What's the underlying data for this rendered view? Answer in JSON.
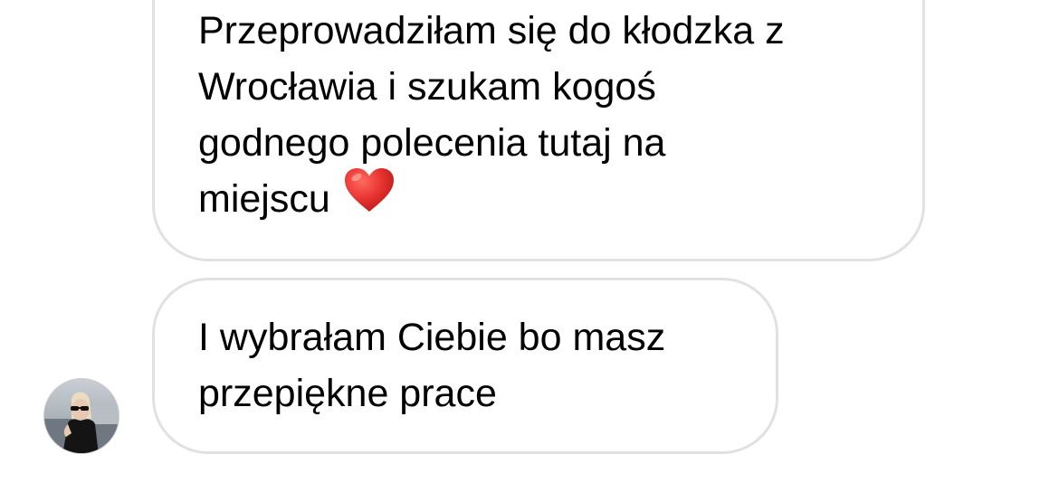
{
  "messages": [
    {
      "lines": [
        "Przeprowadziłam się do kłodzka z",
        "Wrocławia i szukam kogoś",
        "godnego polecenia tutaj na",
        "miejscu"
      ],
      "emoji": "red-heart"
    },
    {
      "lines": [
        "I wybrałam Ciebie bo masz",
        "przepiękne prace"
      ]
    }
  ],
  "colors": {
    "bubble_border": "#e1e1e1",
    "text": "#000000",
    "heart": "#e8332f",
    "background": "#ffffff"
  },
  "icons": {
    "heart": "red-heart-emoji",
    "avatar": "user-profile-photo"
  }
}
